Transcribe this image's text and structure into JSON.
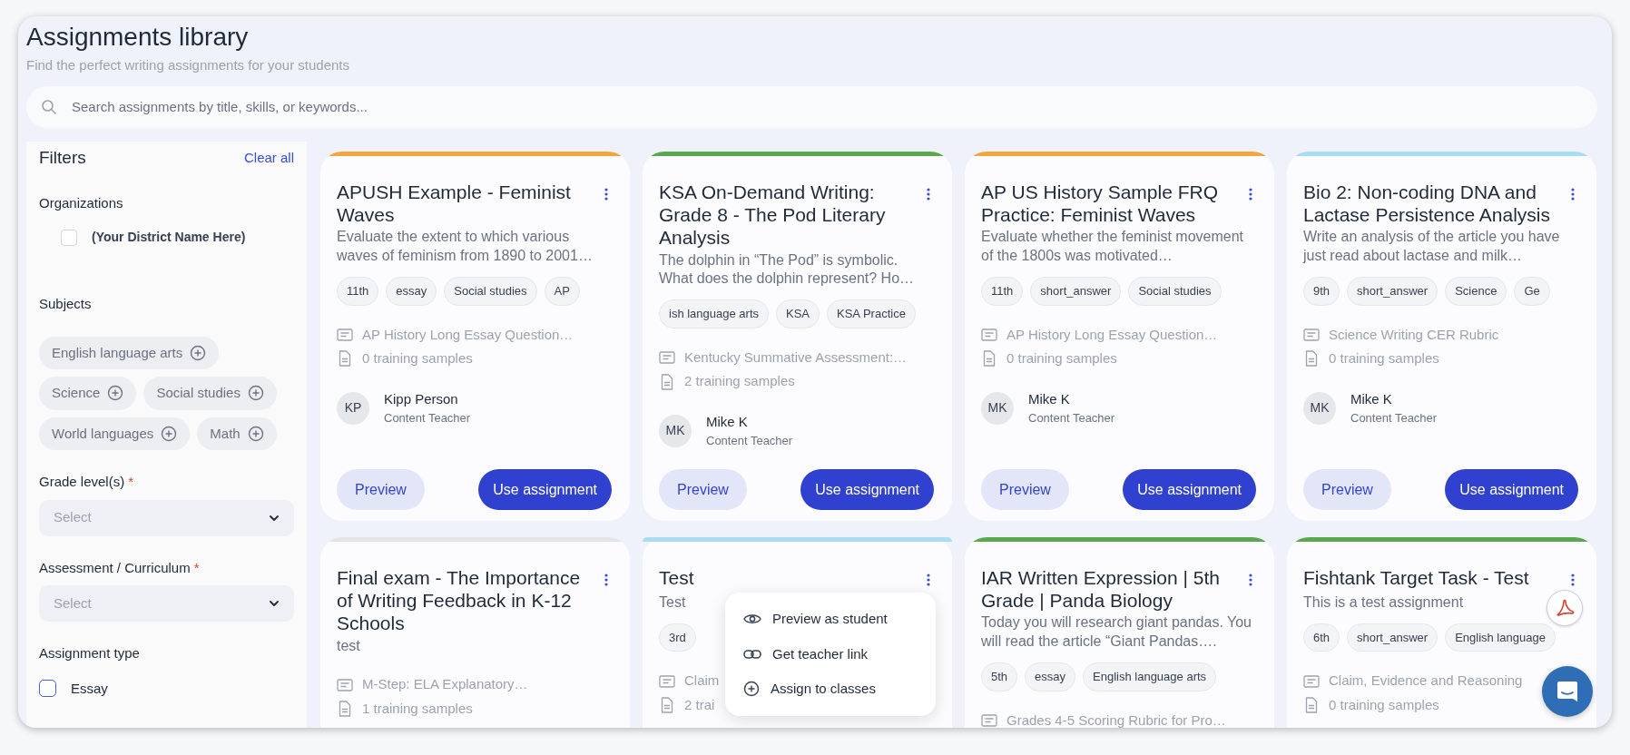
{
  "header": {
    "title": "Assignments library",
    "subtitle": "Find the perfect writing assignments for your students"
  },
  "search": {
    "placeholder": "Search assignments by title, skills, or keywords..."
  },
  "filters": {
    "title": "Filters",
    "clear_all": "Clear all",
    "organizations": {
      "label": "Organizations",
      "items": [
        {
          "label": "(Your District Name Here)",
          "checked": false
        }
      ]
    },
    "subjects": {
      "label": "Subjects",
      "chips": [
        "English language arts",
        "Science",
        "Social studies",
        "World languages",
        "Math"
      ]
    },
    "grade_levels": {
      "label": "Grade level(s)",
      "required_mark": "*",
      "placeholder": "Select"
    },
    "assessment": {
      "label": "Assessment / Curriculum",
      "required_mark": "*",
      "placeholder": "Select"
    },
    "assignment_type": {
      "label": "Assignment type",
      "items": [
        {
          "label": "Essay",
          "checked": false
        }
      ]
    }
  },
  "cards": [
    {
      "color": "#f0a63c",
      "title": "APUSH Example - Feminist Waves",
      "description": "Evaluate the extent to which various waves of feminism from 1890 to 2001…",
      "tags": [
        "11th",
        "essay",
        "Social studies",
        "AP"
      ],
      "rubric": "AP History Long Essay Question…",
      "samples": "0 training samples",
      "author": {
        "initials": "KP",
        "name": "Kipp Person",
        "role": "Content Teacher"
      },
      "preview": "Preview",
      "use": "Use assignment"
    },
    {
      "color": "#5aa84d",
      "title": "KSA On-Demand Writing: Grade 8 - The Pod Literary Analysis",
      "description": "The dolphin in “The Pod” is symbolic. What does the dolphin represent? Ho…",
      "tags": [
        "ish language arts",
        "KSA",
        "KSA Practice"
      ],
      "rubric": "Kentucky Summative Assessment:…",
      "samples": "2 training samples",
      "author": {
        "initials": "MK",
        "name": "Mike K",
        "role": "Content Teacher"
      },
      "preview": "Preview",
      "use": "Use assignment"
    },
    {
      "color": "#f0a63c",
      "title": "AP US History Sample FRQ Practice: Feminist Waves",
      "description": "Evaluate whether the feminist movement of the 1800s was motivated…",
      "tags": [
        "11th",
        "short_answer",
        "Social studies"
      ],
      "rubric": "AP History Long Essay Question…",
      "samples": "0 training samples",
      "author": {
        "initials": "MK",
        "name": "Mike K",
        "role": "Content Teacher"
      },
      "preview": "Preview",
      "use": "Use assignment"
    },
    {
      "color": "#a8dcef",
      "title": "Bio 2: Non-coding DNA and Lactase Persistence Analysis",
      "description": "Write an analysis of the article you have just read about lactase and milk…",
      "tags": [
        "9th",
        "short_answer",
        "Science",
        "Ge"
      ],
      "rubric": "Science Writing CER Rubric",
      "samples": "0 training samples",
      "author": {
        "initials": "MK",
        "name": "Mike K",
        "role": "Content Teacher"
      },
      "preview": "Preview",
      "use": "Use assignment"
    },
    {
      "color": "#e3e4e8",
      "title": "Final exam - The Importance of Writing Feedback in K-12 Schools",
      "description": "test",
      "rubric": "M-Step: ELA Explanatory…",
      "samples": "1 training samples"
    },
    {
      "color": "#a8dcef",
      "title": "Test",
      "description": "Test",
      "tags": [
        "3rd"
      ],
      "rubric": "Claim",
      "samples": "2 trai",
      "menu": {
        "items": [
          {
            "kind": "eye",
            "label": "Preview as student"
          },
          {
            "kind": "link",
            "label": "Get teacher link"
          },
          {
            "kind": "plus",
            "label": "Assign to classes"
          }
        ]
      }
    },
    {
      "color": "#5aa84d",
      "title": "IAR Written Expression | 5th Grade | Panda Biology",
      "description": "Today you will research giant pandas. You will read the article “Giant Pandas….",
      "tags": [
        "5th",
        "essay",
        "English language arts"
      ],
      "rubric": "Grades 4-5 Scoring Rubric for Pro…"
    },
    {
      "color": "#5aa84d",
      "title": "Fishtank Target Task - Test",
      "description": "This is a test assignment",
      "tags": [
        "6th",
        "short_answer",
        "English language"
      ],
      "rubric": "Claim, Evidence and Reasoning",
      "samples": "0 training samples"
    }
  ]
}
